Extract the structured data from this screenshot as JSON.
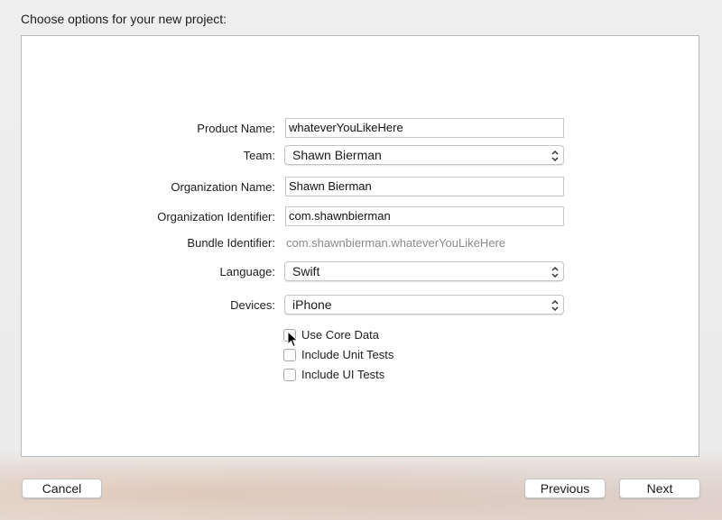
{
  "header": {
    "title": "Choose options for your new project:"
  },
  "form": {
    "product_name": {
      "label": "Product Name:",
      "value": "whateverYouLikeHere"
    },
    "team": {
      "label": "Team:",
      "value": "Shawn Bierman"
    },
    "organization_name": {
      "label": "Organization Name:",
      "value": "Shawn Bierman"
    },
    "organization_identifier": {
      "label": "Organization Identifier:",
      "value": "com.shawnbierman"
    },
    "bundle_identifier": {
      "label": "Bundle Identifier:",
      "value": "com.shawnbierman.whateverYouLikeHere"
    },
    "language": {
      "label": "Language:",
      "value": "Swift"
    },
    "devices": {
      "label": "Devices:",
      "value": "iPhone"
    }
  },
  "options": [
    {
      "label": "Use Core Data",
      "checked": false
    },
    {
      "label": "Include Unit Tests",
      "checked": false
    },
    {
      "label": "Include UI Tests",
      "checked": false
    }
  ],
  "footer": {
    "cancel_label": "Cancel",
    "previous_label": "Previous",
    "next_label": "Next"
  },
  "icons": {
    "popup_indicator": "up-down-chevron-icon",
    "cursor": "mouse-pointer-icon"
  }
}
